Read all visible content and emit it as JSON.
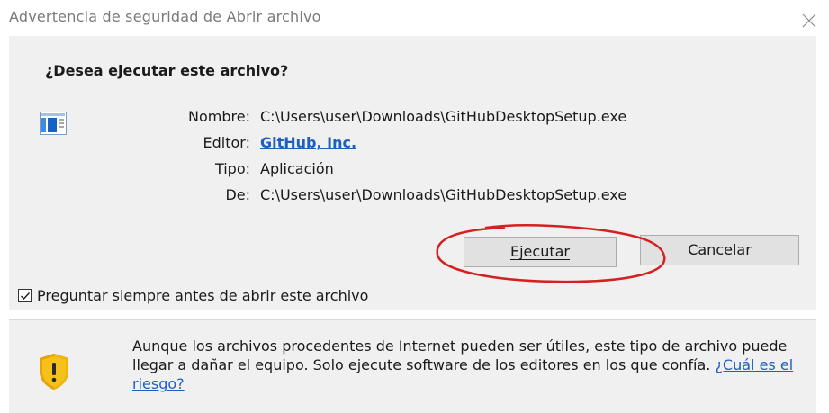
{
  "window": {
    "title": "Advertencia de seguridad de Abrir archivo",
    "close_icon": "close-icon"
  },
  "prompt": {
    "question": "¿Desea ejecutar este archivo?"
  },
  "file": {
    "icon": "application-window-icon",
    "rows": [
      {
        "label": "Nombre:",
        "value": "C:\\Users\\user\\Downloads\\GitHubDesktopSetup.exe"
      },
      {
        "label": "Editor:",
        "value": "GitHub, Inc."
      },
      {
        "label": "Tipo:",
        "value": "Aplicación"
      },
      {
        "label": "De:",
        "value": "C:\\Users\\user\\Downloads\\GitHubDesktopSetup.exe"
      }
    ]
  },
  "buttons": {
    "run": "Ejecutar",
    "cancel": "Cancelar"
  },
  "checkbox": {
    "checked": true,
    "label": "Preguntar siempre antes de abrir este archivo"
  },
  "warning": {
    "icon": "shield-warning-icon",
    "text": "Aunque los archivos procedentes de Internet pueden ser útiles, este tipo de archivo puede llegar a dañar el equipo. Solo ejecute software de los editores en los que confía.",
    "link": "¿Cuál es el riesgo?"
  },
  "colors": {
    "link": "#1f5fbd",
    "annotation": "#d42020",
    "background": "#f0f0f0"
  }
}
